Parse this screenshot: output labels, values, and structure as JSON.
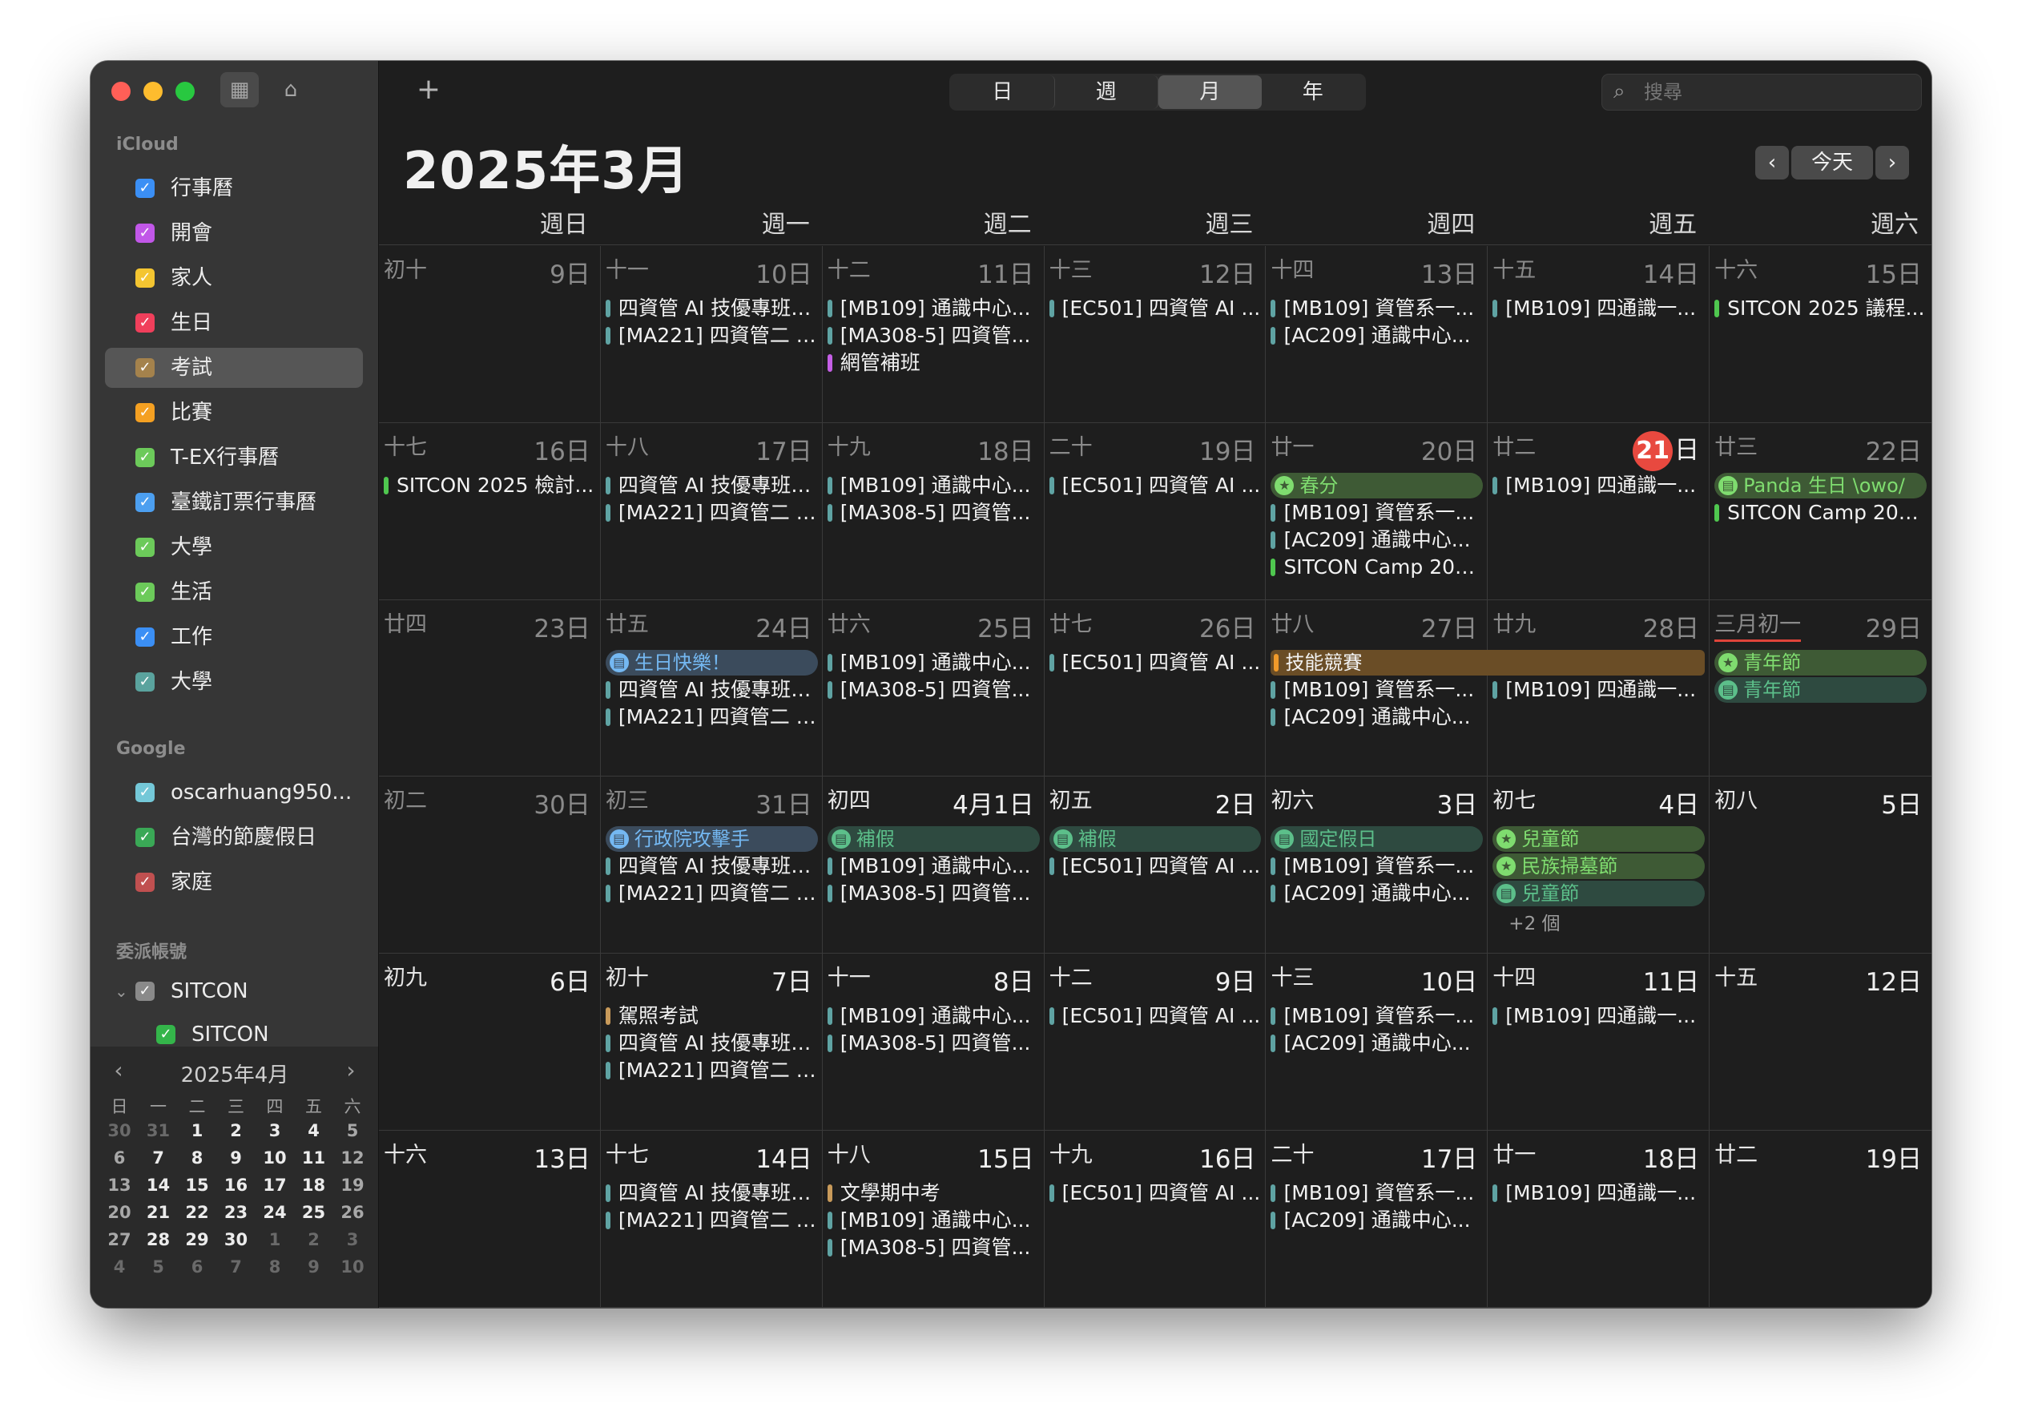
{
  "sidebar": {
    "icloud_header": "iCloud",
    "icloud": [
      {
        "label": "行事曆",
        "color": "#3b8ff5"
      },
      {
        "label": "開會",
        "color": "#c157e8"
      },
      {
        "label": "家人",
        "color": "#f4c531"
      },
      {
        "label": "生日",
        "color": "#f03f5b"
      },
      {
        "label": "考試",
        "color": "#a4824c",
        "selected": true
      },
      {
        "label": "比賽",
        "color": "#f4a022"
      },
      {
        "label": "T-EX行事曆",
        "color": "#6cca5a"
      },
      {
        "label": "臺鐵訂票行事曆",
        "color": "#4c9ff0"
      },
      {
        "label": "大學",
        "color": "#6cca5a"
      },
      {
        "label": "生活",
        "color": "#6cca5a"
      },
      {
        "label": "工作",
        "color": "#3b8ff5"
      },
      {
        "label": "大學",
        "color": "#5aa39e"
      }
    ],
    "google_header": "Google",
    "google": [
      {
        "label": "oscarhuang950...",
        "color": "#74c8d8"
      },
      {
        "label": "台灣的節慶假日",
        "color": "#3aa856"
      },
      {
        "label": "家庭",
        "color": "#c05050"
      }
    ],
    "delegate_header": "委派帳號",
    "delegate_parent": "SITCON",
    "delegate_child": "SITCON",
    "minical": {
      "title": "2025年4月",
      "dow": [
        "日",
        "一",
        "二",
        "三",
        "四",
        "五",
        "六"
      ],
      "weeks": [
        [
          "30",
          "31",
          "1",
          "2",
          "3",
          "4",
          "5"
        ],
        [
          "6",
          "7",
          "8",
          "9",
          "10",
          "11",
          "12"
        ],
        [
          "13",
          "14",
          "15",
          "16",
          "17",
          "18",
          "19"
        ],
        [
          "20",
          "21",
          "22",
          "23",
          "24",
          "25",
          "26"
        ],
        [
          "27",
          "28",
          "29",
          "30",
          "1",
          "2",
          "3"
        ],
        [
          "4",
          "5",
          "6",
          "7",
          "8",
          "9",
          "10"
        ]
      ]
    }
  },
  "toolbar": {
    "add": "+",
    "views": [
      "日",
      "週",
      "月",
      "年"
    ],
    "active_view": "月",
    "search_placeholder": "搜尋"
  },
  "header": {
    "title": "2025年3月",
    "prev": "‹",
    "today": "今天",
    "next": "›",
    "weekdays": [
      "週日",
      "週一",
      "週二",
      "週三",
      "週四",
      "週五",
      "週六"
    ]
  },
  "colors": {
    "teal": "#5fa3a3",
    "green": "#4fc74f",
    "purple": "#c55fe6",
    "tan": "#c89a5a",
    "orange": "#f09a2a",
    "blue": "#5aa8f0",
    "today_red": "#e8493f"
  },
  "weeks": [
    [
      {
        "lunar": "初十",
        "day": "9日",
        "events": []
      },
      {
        "lunar": "十一",
        "day": "10日",
        "events": [
          {
            "t": "四資管 AI 技優專班一...",
            "c": "teal"
          },
          {
            "t": "[MA221] 四資管二 A...",
            "c": "teal"
          }
        ]
      },
      {
        "lunar": "十二",
        "day": "11日",
        "events": [
          {
            "t": "[MB109] 通識中心...",
            "c": "teal"
          },
          {
            "t": "[MA308-5] 四資管...",
            "c": "teal"
          },
          {
            "t": "網管補班",
            "c": "purple"
          }
        ]
      },
      {
        "lunar": "十三",
        "day": "12日",
        "events": [
          {
            "t": "[EC501] 四資管 AI ...",
            "c": "teal"
          }
        ]
      },
      {
        "lunar": "十四",
        "day": "13日",
        "events": [
          {
            "t": "[MB109] 資管系一...",
            "c": "teal"
          },
          {
            "t": "[AC209] 通識中心...",
            "c": "teal"
          }
        ]
      },
      {
        "lunar": "十五",
        "day": "14日",
        "events": [
          {
            "t": "[MB109] 四通識一...",
            "c": "teal"
          }
        ]
      },
      {
        "lunar": "十六",
        "day": "15日",
        "events": [
          {
            "t": "SITCON 2025 議程...",
            "c": "green"
          }
        ]
      }
    ],
    [
      {
        "lunar": "十七",
        "day": "16日",
        "events": [
          {
            "t": "SITCON 2025 檢討...",
            "c": "green"
          }
        ]
      },
      {
        "lunar": "十八",
        "day": "17日",
        "events": [
          {
            "t": "四資管 AI 技優專班一...",
            "c": "teal"
          },
          {
            "t": "[MA221] 四資管二 A...",
            "c": "teal"
          }
        ]
      },
      {
        "lunar": "十九",
        "day": "18日",
        "events": [
          {
            "t": "[MB109] 通識中心...",
            "c": "teal"
          },
          {
            "t": "[MA308-5] 四資管...",
            "c": "teal"
          }
        ]
      },
      {
        "lunar": "二十",
        "day": "19日",
        "events": [
          {
            "t": "[EC501] 四資管 AI ...",
            "c": "teal"
          }
        ]
      },
      {
        "lunar": "廿一",
        "day": "20日",
        "events": [
          {
            "t": "[MB109] 資管系一...",
            "c": "teal"
          },
          {
            "t": "[AC209] 通識中心...",
            "c": "teal"
          },
          {
            "t": "SITCON Camp 202...",
            "c": "green"
          }
        ]
      },
      {
        "lunar": "廿二",
        "day": "日",
        "today": "21",
        "events": [
          {
            "t": "[MB109] 四通識一...",
            "c": "teal"
          }
        ]
      },
      {
        "lunar": "廿三",
        "day": "22日",
        "events": [
          {
            "t": "SITCON Camp 202...",
            "c": "green"
          }
        ]
      }
    ],
    [
      {
        "lunar": "廿四",
        "day": "23日",
        "events": []
      },
      {
        "lunar": "廿五",
        "day": "24日",
        "events": [
          {
            "t": "四資管 AI 技優專班一...",
            "c": "teal"
          },
          {
            "t": "[MA221] 四資管二 A...",
            "c": "teal"
          }
        ]
      },
      {
        "lunar": "廿六",
        "day": "25日",
        "events": [
          {
            "t": "[MB109] 通識中心...",
            "c": "teal"
          },
          {
            "t": "[MA308-5] 四資管...",
            "c": "teal"
          }
        ]
      },
      {
        "lunar": "廿七",
        "day": "26日",
        "events": [
          {
            "t": "[EC501] 四資管 AI ...",
            "c": "teal"
          }
        ]
      },
      {
        "lunar": "廿八",
        "day": "27日",
        "events": [
          {
            "t": "[MB109] 資管系一...",
            "c": "teal"
          },
          {
            "t": "[AC209] 通識中心...",
            "c": "teal"
          }
        ]
      },
      {
        "lunar": "廿九",
        "day": "28日",
        "events": [
          {
            "t": "[MB109] 四通識一...",
            "c": "teal"
          }
        ]
      },
      {
        "lunar": "三月初一",
        "day": "29日",
        "events": []
      }
    ],
    [
      {
        "lunar": "初二",
        "day": "30日",
        "events": []
      },
      {
        "lunar": "初三",
        "day": "31日",
        "events": [
          {
            "t": "四資管 AI 技優專班一...",
            "c": "teal"
          },
          {
            "t": "[MA221] 四資管二 A...",
            "c": "teal"
          }
        ]
      },
      {
        "lunar": "初四",
        "day": "4月1日",
        "cur": true,
        "events": [
          {
            "t": "[MB109] 通識中心...",
            "c": "teal"
          },
          {
            "t": "[MA308-5] 四資管...",
            "c": "teal"
          }
        ]
      },
      {
        "lunar": "初五",
        "day": "2日",
        "cur": true,
        "events": [
          {
            "t": "[EC501] 四資管 AI ...",
            "c": "teal"
          }
        ]
      },
      {
        "lunar": "初六",
        "day": "3日",
        "cur": true,
        "events": [
          {
            "t": "[MB109] 資管系一...",
            "c": "teal"
          },
          {
            "t": "[AC209] 通識中心...",
            "c": "teal"
          }
        ]
      },
      {
        "lunar": "初七",
        "day": "4日",
        "cur": true,
        "events": [],
        "more": "+2 個"
      },
      {
        "lunar": "初八",
        "day": "5日",
        "cur": true,
        "events": []
      }
    ],
    [
      {
        "lunar": "初九",
        "day": "6日",
        "cur": true,
        "events": []
      },
      {
        "lunar": "初十",
        "day": "7日",
        "cur": true,
        "events": [
          {
            "t": "駕照考試",
            "c": "tan"
          },
          {
            "t": "四資管 AI 技優專班一...",
            "c": "teal"
          },
          {
            "t": "[MA221] 四資管二 A...",
            "c": "teal"
          }
        ]
      },
      {
        "lunar": "十一",
        "day": "8日",
        "cur": true,
        "events": [
          {
            "t": "[MB109] 通識中心...",
            "c": "teal"
          },
          {
            "t": "[MA308-5] 四資管...",
            "c": "teal"
          }
        ]
      },
      {
        "lunar": "十二",
        "day": "9日",
        "cur": true,
        "events": [
          {
            "t": "[EC501] 四資管 AI ...",
            "c": "teal"
          }
        ]
      },
      {
        "lunar": "十三",
        "day": "10日",
        "cur": true,
        "events": [
          {
            "t": "[MB109] 資管系一...",
            "c": "teal"
          },
          {
            "t": "[AC209] 通識中心...",
            "c": "teal"
          }
        ]
      },
      {
        "lunar": "十四",
        "day": "11日",
        "cur": true,
        "events": [
          {
            "t": "[MB109] 四通識一...",
            "c": "teal"
          }
        ]
      },
      {
        "lunar": "十五",
        "day": "12日",
        "cur": true,
        "events": []
      }
    ],
    [
      {
        "lunar": "十六",
        "day": "13日",
        "cur": true,
        "events": []
      },
      {
        "lunar": "十七",
        "day": "14日",
        "cur": true,
        "events": [
          {
            "t": "四資管 AI 技優專班一...",
            "c": "teal"
          },
          {
            "t": "[MA221] 四資管二 A...",
            "c": "teal"
          }
        ]
      },
      {
        "lunar": "十八",
        "day": "15日",
        "cur": true,
        "events": [
          {
            "t": "文學期中考",
            "c": "tan"
          },
          {
            "t": "[MB109] 通識中心...",
            "c": "teal"
          },
          {
            "t": "[MA308-5] 四資管...",
            "c": "teal"
          }
        ]
      },
      {
        "lunar": "十九",
        "day": "16日",
        "cur": true,
        "events": [
          {
            "t": "[EC501] 四資管 AI ...",
            "c": "teal"
          }
        ]
      },
      {
        "lunar": "二十",
        "day": "17日",
        "cur": true,
        "events": [
          {
            "t": "[MB109] 資管系一...",
            "c": "teal"
          },
          {
            "t": "[AC209] 通識中心...",
            "c": "teal"
          }
        ]
      },
      {
        "lunar": "廿一",
        "day": "18日",
        "cur": true,
        "events": [
          {
            "t": "[MB109] 四通識一...",
            "c": "teal"
          }
        ]
      },
      {
        "lunar": "廿二",
        "day": "19日",
        "cur": true,
        "events": []
      }
    ]
  ],
  "pills": [
    {
      "w": 1,
      "d": 4,
      "t": "春分",
      "icon": "★",
      "bg": "#3e5a35",
      "fg": "#7fdc6f",
      "span": 1
    },
    {
      "w": 1,
      "d": 6,
      "t": "Panda 生日 \\owo/",
      "icon": "▤",
      "bg": "#3e5a35",
      "fg": "#7fdc6f",
      "span": 1
    },
    {
      "w": 2,
      "d": 1,
      "t": "生日快樂！",
      "icon": "▤",
      "bg": "#3b4b5c",
      "fg": "#74b8f2",
      "span": 1
    },
    {
      "w": 2,
      "d": 4,
      "t": "技能競賽",
      "bg": "#6a4d26",
      "fg": "#f2f2f2",
      "bar": "#f09a2a",
      "span": 2
    },
    {
      "w": 2,
      "d": 6,
      "t": "青年節",
      "icon": "★",
      "bg": "#3e5a35",
      "fg": "#7fdc6f",
      "span": 1
    },
    {
      "w": 2,
      "d": 6,
      "t": "青年節",
      "icon": "▤",
      "bg": "#2e4a40",
      "fg": "#5cbf8a",
      "span": 1,
      "row": 1
    },
    {
      "w": 3,
      "d": 1,
      "t": "行政院攻擊手",
      "icon": "▤",
      "bg": "#3b4b5c",
      "fg": "#74b8f2",
      "span": 1
    },
    {
      "w": 3,
      "d": 2,
      "t": "補假",
      "icon": "▤",
      "bg": "#2e4a40",
      "fg": "#5cbf8a",
      "span": 1
    },
    {
      "w": 3,
      "d": 3,
      "t": "補假",
      "icon": "▤",
      "bg": "#2e4a40",
      "fg": "#5cbf8a",
      "span": 1
    },
    {
      "w": 3,
      "d": 4,
      "t": "國定假日",
      "icon": "▤",
      "bg": "#2e4a40",
      "fg": "#5cbf8a",
      "span": 1
    },
    {
      "w": 3,
      "d": 5,
      "t": "兒童節",
      "icon": "★",
      "bg": "#3e5a35",
      "fg": "#7fdc6f",
      "span": 1
    },
    {
      "w": 3,
      "d": 5,
      "t": "民族掃墓節",
      "icon": "★",
      "bg": "#3e5a35",
      "fg": "#7fdc6f",
      "span": 1,
      "row": 1
    },
    {
      "w": 3,
      "d": 5,
      "t": "兒童節",
      "icon": "▤",
      "bg": "#2e4a40",
      "fg": "#5cbf8a",
      "span": 1,
      "row": 2
    }
  ]
}
